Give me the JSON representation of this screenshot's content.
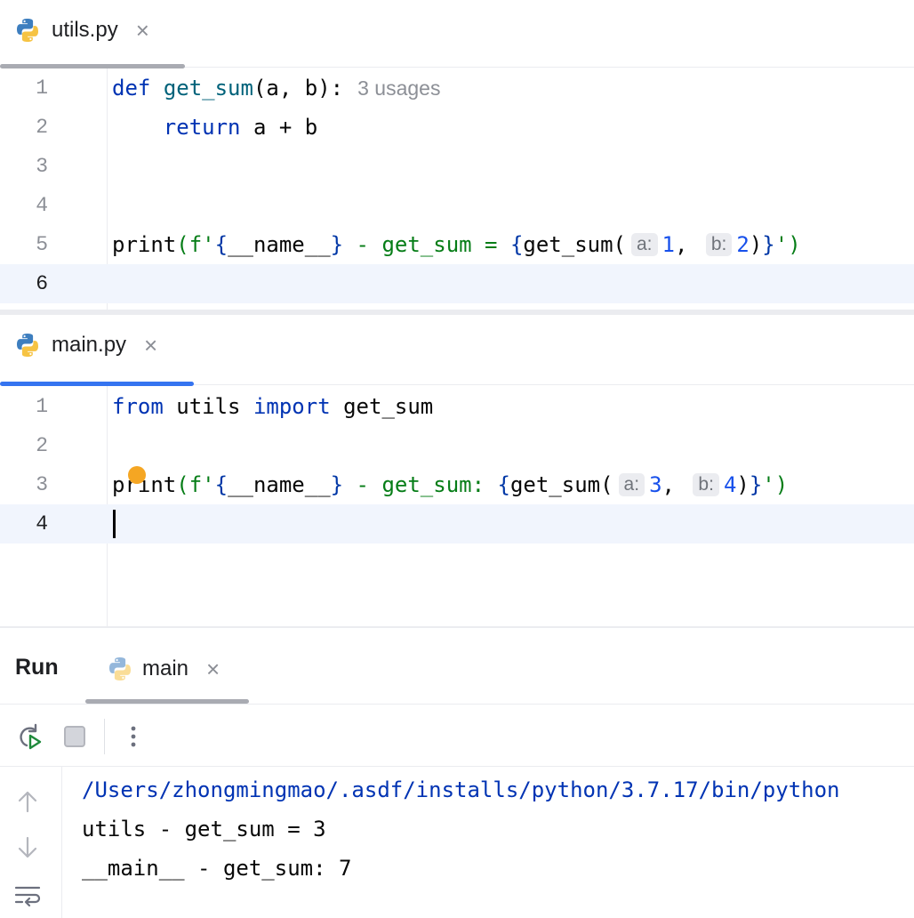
{
  "editor_top": {
    "tab": {
      "label": "utils.py",
      "close": "×",
      "icon": "python-icon"
    },
    "lines": [
      {
        "n": "1"
      },
      {
        "n": "2"
      },
      {
        "n": "3"
      },
      {
        "n": "4"
      },
      {
        "n": "5"
      },
      {
        "n": "6"
      }
    ],
    "code": {
      "l1_kw": "def",
      "l1_fn": "get_sum",
      "l1_rest": "(a, b):",
      "l1_hint": "3 usages",
      "l2_kw": "return",
      "l2_rest": " a + b",
      "l5_fn": "print",
      "l5_open": "(f'",
      "l5_b1": "{",
      "l5_name": "__name__",
      "l5_b2": "}",
      "l5_mid": " - get_sum = ",
      "l5_b3": "{",
      "l5_call": "get_sum(",
      "l5_hint_a": "a:",
      "l5_v1": "1",
      "l5_comma": ", ",
      "l5_hint_b": "b:",
      "l5_v2": "2",
      "l5_close1": ")",
      "l5_b4": "}",
      "l5_end": "')"
    },
    "current_line": "6"
  },
  "editor_bottom": {
    "tab": {
      "label": "main.py",
      "close": "×",
      "icon": "python-icon"
    },
    "lines": [
      {
        "n": "1"
      },
      {
        "n": "2"
      },
      {
        "n": "3"
      },
      {
        "n": "4"
      }
    ],
    "code": {
      "l1_kw1": "from",
      "l1_mod": " utils ",
      "l1_kw2": "import",
      "l1_rest": " get_sum",
      "l3_fn": "print",
      "l3_open": "(f'",
      "l3_b1": "{",
      "l3_name": "__name__",
      "l3_b2": "}",
      "l3_mid": " - get_sum: ",
      "l3_b3": "{",
      "l3_call": "get_sum(",
      "l3_hint_a": "a:",
      "l3_v1": "3",
      "l3_comma": ", ",
      "l3_hint_b": "b:",
      "l3_v2": "4",
      "l3_close1": ")",
      "l3_b4": "}",
      "l3_end": "')"
    },
    "current_line": "4"
  },
  "run_panel": {
    "title": "Run",
    "tab": {
      "label": "main",
      "close": "×",
      "icon": "python-icon"
    },
    "toolbar": [
      "rerun-icon",
      "stop-icon",
      "more-options-icon"
    ],
    "side": [
      "scroll-up-icon",
      "scroll-down-icon",
      "soft-wrap-icon"
    ],
    "output": [
      "/Users/zhongmingmao/.asdf/installs/python/3.7.17/bin/python",
      "utils - get_sum = 3",
      "__main__ - get_sum: 7"
    ]
  },
  "colors": {
    "keyword": "#0033b3",
    "function": "#00627a",
    "string": "#067d17",
    "number": "#1750eb",
    "active_tab": "#3574f0",
    "current_line_bg": "#f1f5fd"
  }
}
